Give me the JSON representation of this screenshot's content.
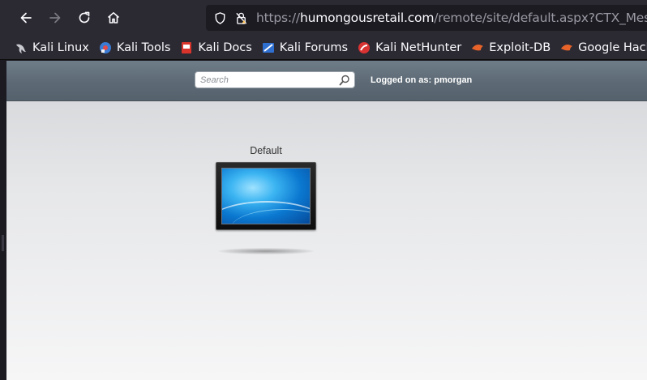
{
  "browser": {
    "url_prefix": "https://",
    "url_host": "humongousretail.com",
    "url_path": "/remote/site/default.aspx?CTX_MessageT"
  },
  "bookmarks": [
    {
      "label": "Kali Linux",
      "icon": "kali-dragon-icon"
    },
    {
      "label": "Kali Tools",
      "icon": "kali-tools-icon"
    },
    {
      "label": "Kali Docs",
      "icon": "kali-docs-icon"
    },
    {
      "label": "Kali Forums",
      "icon": "kali-forums-icon"
    },
    {
      "label": "Kali NetHunter",
      "icon": "kali-nethunter-icon"
    },
    {
      "label": "Exploit-DB",
      "icon": "exploit-db-icon"
    },
    {
      "label": "Google Hacking DB",
      "icon": "exploit-db-icon"
    }
  ],
  "citrix": {
    "search_placeholder": "Search",
    "logged_on": "Logged on as: pmorgan"
  },
  "desktop": {
    "label": "Default"
  }
}
